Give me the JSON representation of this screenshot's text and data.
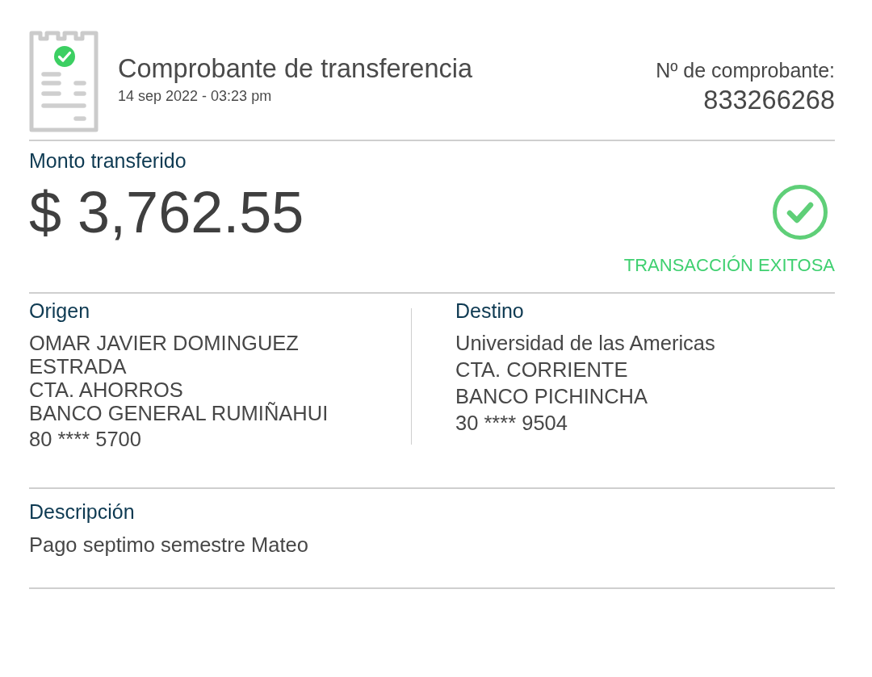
{
  "header": {
    "title": "Comprobante de transferencia",
    "date": "14 sep 2022 - 03:23 pm",
    "receipt_number_label": "Nº de comprobante:",
    "receipt_number": "833266268"
  },
  "amount": {
    "label": "Monto transferido",
    "value": "$ 3,762.55"
  },
  "status": {
    "kind": "success",
    "label": "TRANSACCIÓN EXITOSA"
  },
  "parties": [
    {
      "label": "Origen",
      "name": "OMAR JAVIER DOMINGUEZ ESTRADA",
      "account_type": "CTA. AHORROS",
      "bank": "BANCO GENERAL RUMIÑAHUI",
      "account_number": "80 **** 5700"
    },
    {
      "label": "Destino",
      "name": "Universidad de las Americas",
      "account_type": "CTA. CORRIENTE",
      "bank": "BANCO PICHINCHA",
      "account_number": "30 **** 9504"
    }
  ],
  "description": {
    "label": "Descripción",
    "text": "Pago septimo semestre Mateo"
  }
}
